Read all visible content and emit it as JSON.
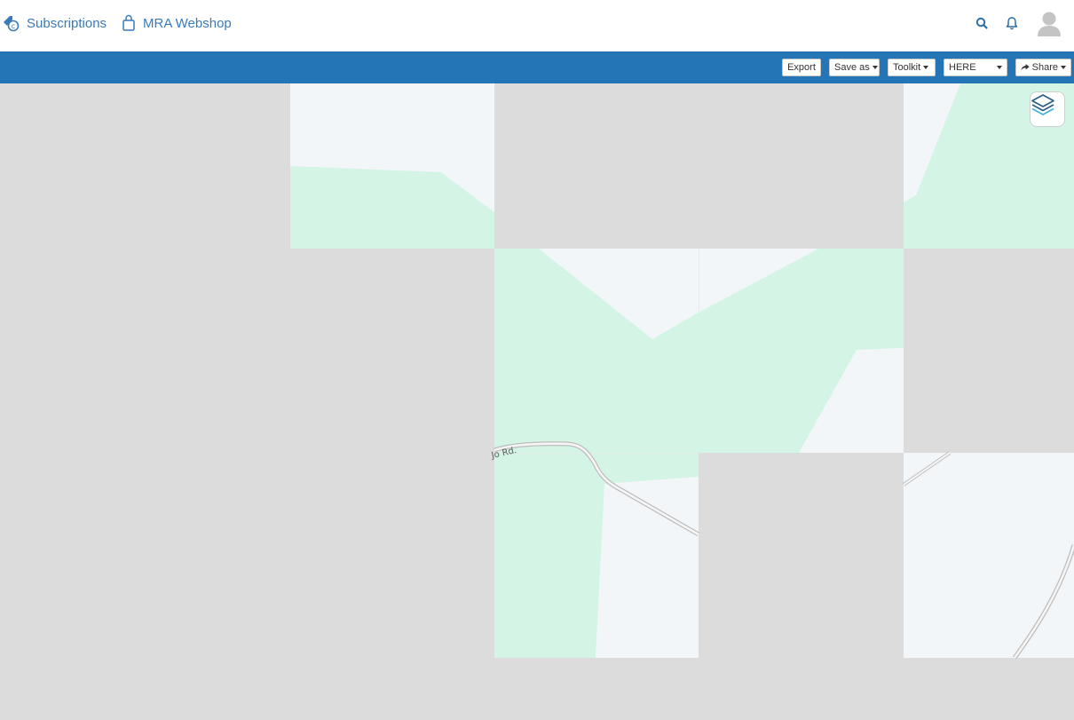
{
  "nav": {
    "subscriptions_label": "Subscriptions",
    "webshop_label": "MRA Webshop",
    "subscriptions_icon": "tag-coin-icon",
    "webshop_icon": "shopping-bag-icon",
    "search_icon": "search-icon",
    "notifications_icon": "bell-icon",
    "avatar_icon": "user-avatar-icon"
  },
  "toolbar": {
    "export_label": "Export",
    "saveas_label": "Save as",
    "toolkit_label": "Toolkit",
    "provider_value": "HERE",
    "share_label": "Share",
    "share_icon": "share-arrow-icon"
  },
  "map": {
    "road_label": "Jo Rd.",
    "layers_icon": "layers-icon"
  },
  "colors": {
    "toolbar_bg": "#2475b5",
    "link": "#3a7ab8",
    "map_missing_tile": "#dcdcdc",
    "map_land": "#f3f6f9",
    "map_green": "#d4f5e6",
    "road": "#d8d8d8"
  }
}
